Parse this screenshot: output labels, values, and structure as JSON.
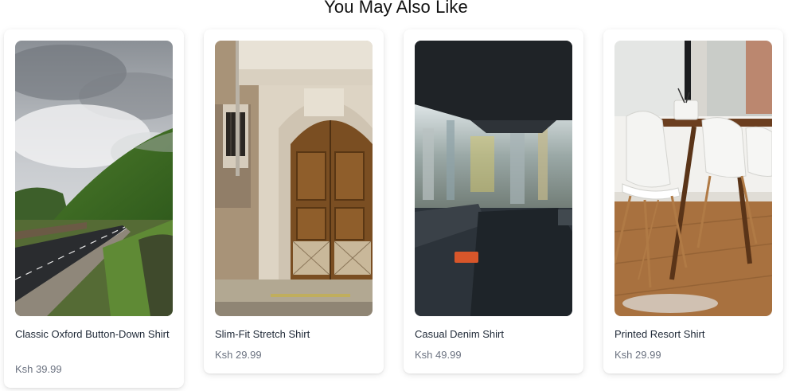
{
  "section": {
    "title": "You May Also Like"
  },
  "products": [
    {
      "name": "Classic Oxford Button-Down Shirt",
      "price": "Ksh 39.99",
      "image": "mountain-road-photo"
    },
    {
      "name": "Slim-Fit Stretch Shirt",
      "price": "Ksh 29.99",
      "image": "wooden-door-photo"
    },
    {
      "name": "Casual Denim Shirt",
      "price": "Ksh 49.99",
      "image": "blurred-city-window-photo"
    },
    {
      "name": "Printed Resort Shirt",
      "price": "Ksh 29.99",
      "image": "dining-chairs-photo"
    }
  ]
}
